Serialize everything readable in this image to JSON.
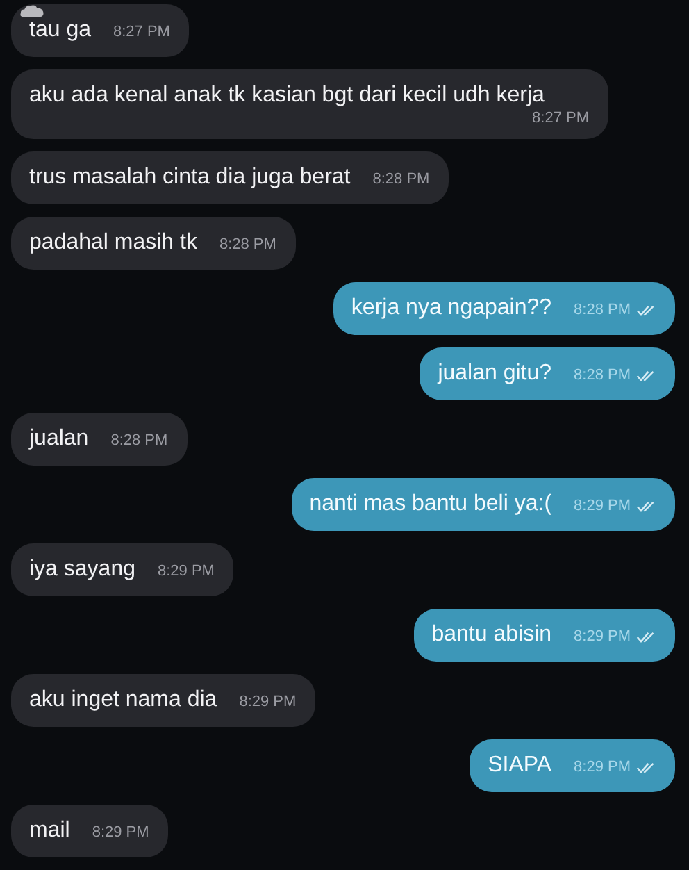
{
  "messages": [
    {
      "kind": "incoming",
      "text": "tau ga",
      "time": "8:27 PM",
      "sticker": true
    },
    {
      "kind": "incoming",
      "text": "aku ada kenal anak tk kasian bgt dari kecil udh kerja",
      "time": "8:27 PM"
    },
    {
      "kind": "incoming",
      "text": "trus masalah cinta dia juga berat",
      "time": "8:28 PM"
    },
    {
      "kind": "incoming",
      "text": "padahal masih tk",
      "time": "8:28 PM"
    },
    {
      "kind": "outgoing",
      "text": "kerja nya ngapain??",
      "time": "8:28 PM",
      "read": true
    },
    {
      "kind": "outgoing",
      "text": "jualan gitu?",
      "time": "8:28 PM",
      "read": true
    },
    {
      "kind": "incoming",
      "text": "jualan",
      "time": "8:28 PM"
    },
    {
      "kind": "outgoing",
      "text": "nanti mas bantu beli ya:(",
      "time": "8:29 PM",
      "read": true
    },
    {
      "kind": "incoming",
      "text": "iya sayang",
      "time": "8:29 PM"
    },
    {
      "kind": "outgoing",
      "text": "bantu abisin",
      "time": "8:29 PM",
      "read": true
    },
    {
      "kind": "incoming",
      "text": "aku inget nama dia",
      "time": "8:29 PM"
    },
    {
      "kind": "outgoing",
      "text": "SIAPA",
      "time": "8:29 PM",
      "read": true
    },
    {
      "kind": "incoming",
      "text": "mail",
      "time": "8:29 PM"
    }
  ]
}
